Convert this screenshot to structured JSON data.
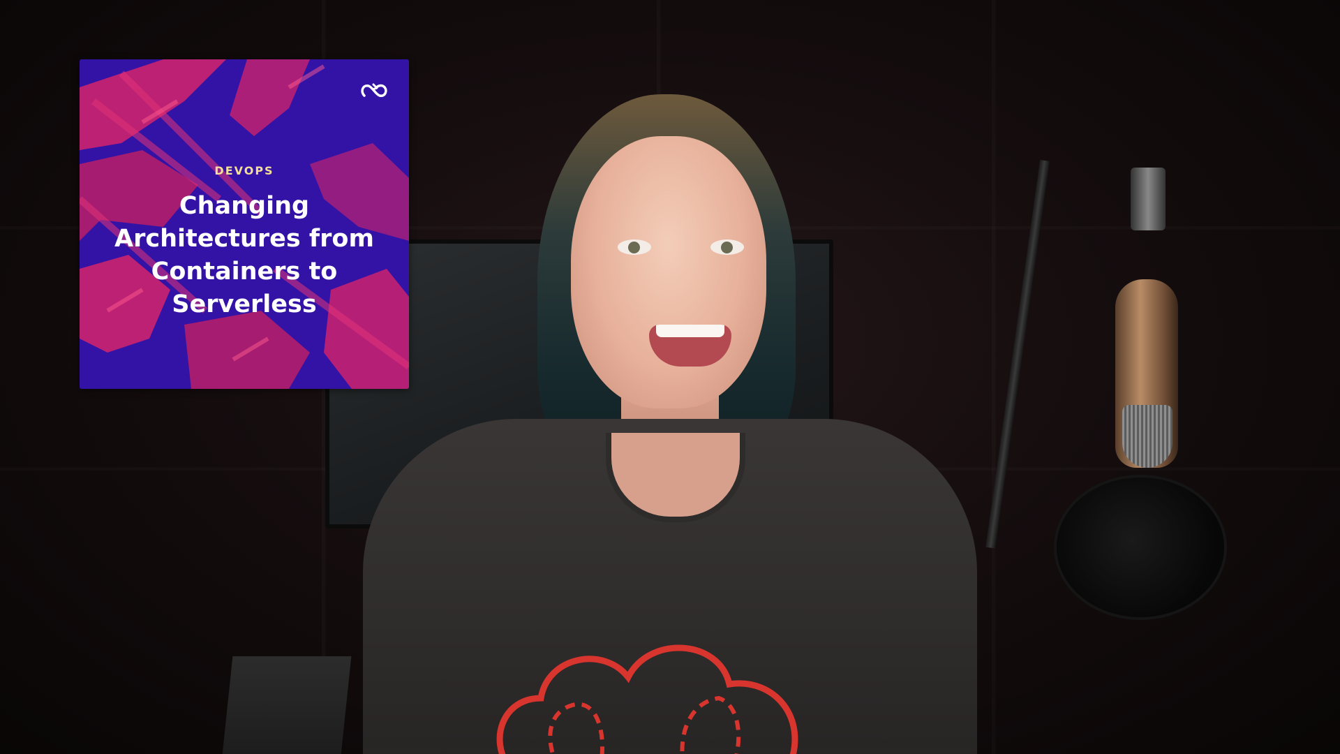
{
  "course_card": {
    "category": "DEVOPS",
    "title": "Changing Architectures from Containers to Serverless",
    "brand_icon": "loop-icon",
    "colors": {
      "background": "#3312a6",
      "pattern": "#d6246a",
      "category_text": "#f4df9a",
      "title_text": "#ffffff"
    }
  },
  "scene": {
    "shirt_graphic": "cloud-icon"
  }
}
